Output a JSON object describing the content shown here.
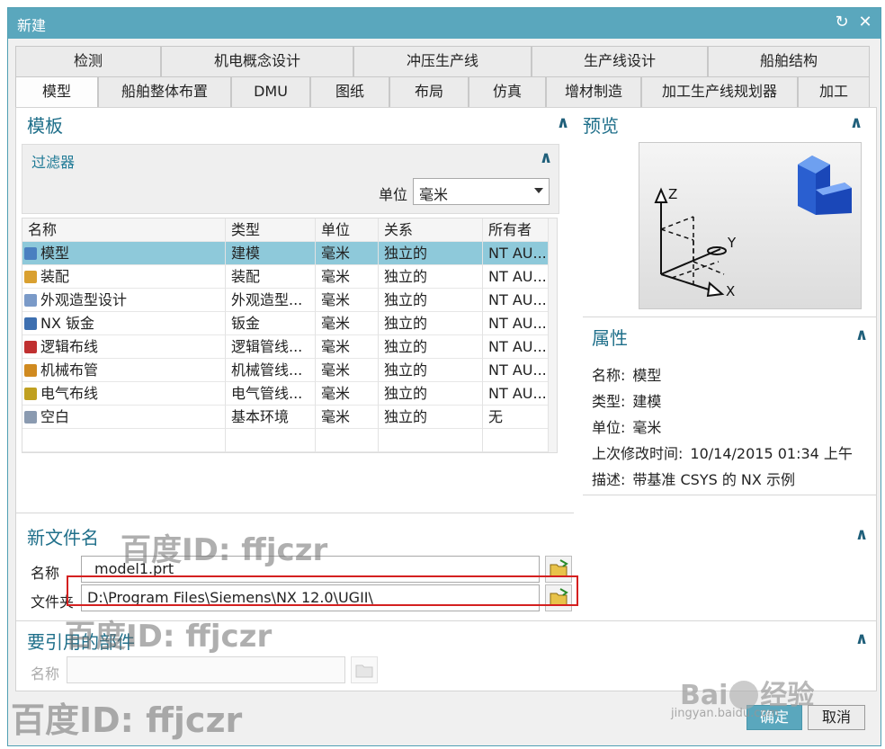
{
  "window": {
    "title": "新建",
    "refresh_icon": "↻",
    "close_icon": "✕"
  },
  "tabs_back": [
    "检测",
    "机电概念设计",
    "冲压生产线",
    "生产线设计",
    "船舶结构"
  ],
  "tabs_front": [
    "模型",
    "船舶整体布置",
    "DMU",
    "图纸",
    "布局",
    "仿真",
    "增材制造",
    "加工生产线规划器",
    "加工"
  ],
  "active_tab": "模型",
  "template": {
    "title": "模板",
    "filter_title": "过滤器",
    "unit_label": "单位",
    "unit_value": "毫米",
    "columns": [
      "名称",
      "类型",
      "单位",
      "关系",
      "所有者"
    ],
    "rows": [
      {
        "name": "模型",
        "type": "建模",
        "unit": "毫米",
        "relation": "独立的",
        "owner": "NT AU...",
        "icon": "model-icon",
        "color": "#4a7fc0"
      },
      {
        "name": "装配",
        "type": "装配",
        "unit": "毫米",
        "relation": "独立的",
        "owner": "NT AU...",
        "icon": "assembly-icon",
        "color": "#d9a030"
      },
      {
        "name": "外观造型设计",
        "type": "外观造型...",
        "unit": "毫米",
        "relation": "独立的",
        "owner": "NT AU...",
        "icon": "shape-design-icon",
        "color": "#7a9ac8"
      },
      {
        "name": "NX 钣金",
        "type": "钣金",
        "unit": "毫米",
        "relation": "独立的",
        "owner": "NT AU...",
        "icon": "sheet-metal-icon",
        "color": "#3d6fb0"
      },
      {
        "name": "逻辑布线",
        "type": "逻辑管线...",
        "unit": "毫米",
        "relation": "独立的",
        "owner": "NT AU...",
        "icon": "logical-routing-icon",
        "color": "#c03030"
      },
      {
        "name": "机械布管",
        "type": "机械管线...",
        "unit": "毫米",
        "relation": "独立的",
        "owner": "NT AU...",
        "icon": "mechanical-piping-icon",
        "color": "#d08a20"
      },
      {
        "name": "电气布线",
        "type": "电气管线...",
        "unit": "毫米",
        "relation": "独立的",
        "owner": "NT AU...",
        "icon": "electrical-routing-icon",
        "color": "#c0a020"
      },
      {
        "name": "空白",
        "type": "基本环境",
        "unit": "毫米",
        "relation": "独立的",
        "owner": "无",
        "icon": "blank-icon",
        "color": "#8a9ab0"
      }
    ]
  },
  "preview": {
    "title": "预览",
    "axis_z": "Z",
    "axis_y": "Y",
    "axis_x": "X"
  },
  "properties": {
    "title": "属性",
    "items": [
      {
        "label": "名称:",
        "value": "模型"
      },
      {
        "label": "类型:",
        "value": "建模"
      },
      {
        "label": "单位:",
        "value": "毫米"
      },
      {
        "label": "上次修改时间:",
        "value": "10/14/2015 01:34 上午"
      },
      {
        "label": "描述:",
        "value": "带基准 CSYS 的 NX 示例"
      }
    ]
  },
  "new_file": {
    "title": "新文件名",
    "name_label": "名称",
    "name_value": "_model1.prt",
    "folder_label": "文件夹",
    "folder_value": "D:\\Program Files\\Siemens\\NX 12.0\\UGII\\"
  },
  "referenced_part": {
    "title": "要引用的部件",
    "name_label": "名称",
    "name_value": ""
  },
  "buttons": {
    "ok": "确定",
    "cancel": "取消"
  },
  "watermarks": {
    "baidu_id": "百度ID: ffjczr",
    "baidu_logo": "Bai",
    "baidu_jingyan": "经验",
    "jingyan_url": "jingyan.baidu.com"
  },
  "colors": {
    "titlebar": "#5aa7bd",
    "selected_row": "#8ec9da",
    "section_title": "#1f6f8a",
    "highlight": "#d42020"
  }
}
